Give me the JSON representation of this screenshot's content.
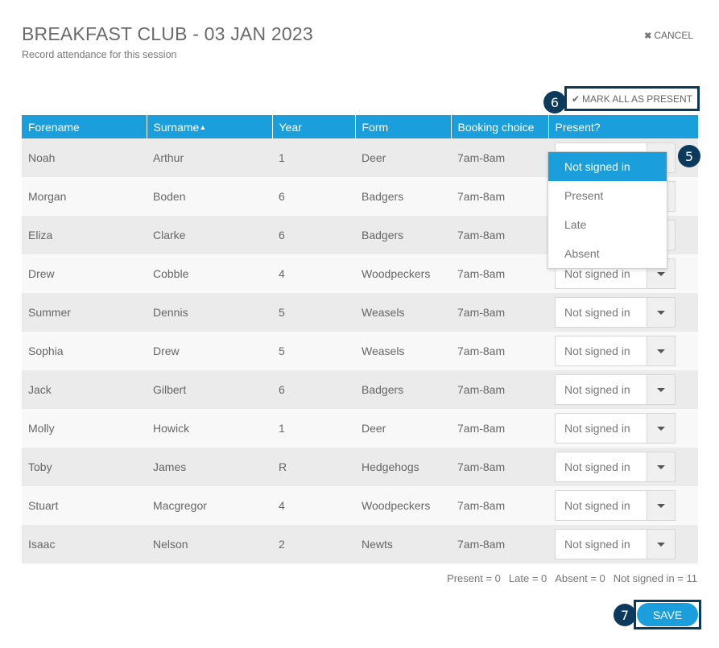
{
  "header": {
    "title": "BREAKFAST CLUB - 03 JAN 2023",
    "subtitle": "Record attendance for this session",
    "cancel_icon": "close-icon",
    "cancel_label": "CANCEL"
  },
  "toolbar": {
    "mark_all_icon": "check-icon",
    "mark_all_label": "MARK ALL AS PRESENT"
  },
  "callouts": {
    "five": "5",
    "six": "6",
    "seven": "7"
  },
  "table": {
    "columns": [
      "Forename",
      "Surname",
      "Year",
      "Form",
      "Booking choice",
      "Present?"
    ],
    "sorted_column": "Surname",
    "sort_direction": "ascending",
    "rows": [
      {
        "forename": "Noah",
        "surname": "Arthur",
        "year": "1",
        "form": "Deer",
        "booking": "7am-8am",
        "present": "Not signed in"
      },
      {
        "forename": "Morgan",
        "surname": "Boden",
        "year": "6",
        "form": "Badgers",
        "booking": "7am-8am",
        "present": "Not signed in"
      },
      {
        "forename": "Eliza",
        "surname": "Clarke",
        "year": "6",
        "form": "Badgers",
        "booking": "7am-8am",
        "present": "Not signed in"
      },
      {
        "forename": "Drew",
        "surname": "Cobble",
        "year": "4",
        "form": "Woodpeckers",
        "booking": "7am-8am",
        "present": "Not signed in"
      },
      {
        "forename": "Summer",
        "surname": "Dennis",
        "year": "5",
        "form": "Weasels",
        "booking": "7am-8am",
        "present": "Not signed in"
      },
      {
        "forename": "Sophia",
        "surname": "Drew",
        "year": "5",
        "form": "Weasels",
        "booking": "7am-8am",
        "present": "Not signed in"
      },
      {
        "forename": "Jack",
        "surname": "Gilbert",
        "year": "6",
        "form": "Badgers",
        "booking": "7am-8am",
        "present": "Not signed in"
      },
      {
        "forename": "Molly",
        "surname": "Howick",
        "year": "1",
        "form": "Deer",
        "booking": "7am-8am",
        "present": "Not signed in"
      },
      {
        "forename": "Toby",
        "surname": "James",
        "year": "R",
        "form": "Hedgehogs",
        "booking": "7am-8am",
        "present": "Not signed in"
      },
      {
        "forename": "Stuart",
        "surname": "Macgregor",
        "year": "4",
        "form": "Woodpeckers",
        "booking": "7am-8am",
        "present": "Not signed in"
      },
      {
        "forename": "Isaac",
        "surname": "Nelson",
        "year": "2",
        "form": "Newts",
        "booking": "7am-8am",
        "present": "Not signed in"
      }
    ]
  },
  "dropdown": {
    "options": [
      "Not signed in",
      "Present",
      "Late",
      "Absent"
    ],
    "highlighted": "Not signed in"
  },
  "summary": {
    "present": "Present = 0",
    "late": "Late = 0",
    "absent": "Absent = 0",
    "not_signed_in": "Not signed in = 11"
  },
  "footer": {
    "save_label": "SAVE"
  },
  "colors": {
    "accent": "#1a9fdc",
    "callout": "#0b3a5c",
    "row_odd": "#ebebeb",
    "row_even": "#f8f8f8"
  }
}
